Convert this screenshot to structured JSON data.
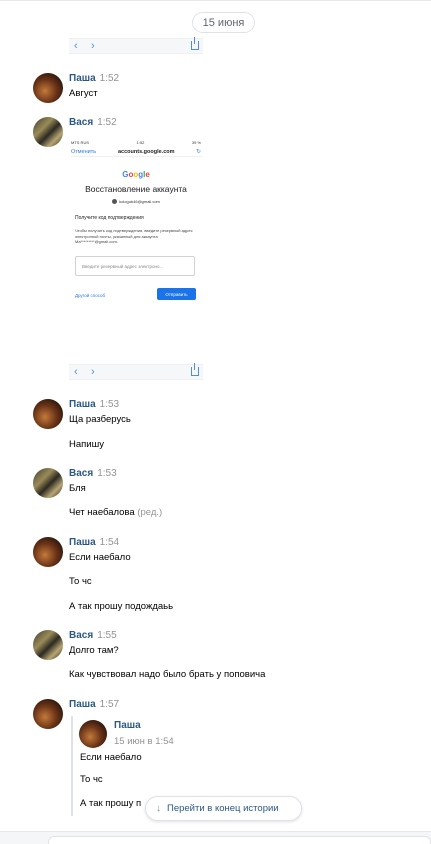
{
  "date_divider": "15 июня",
  "icons": {
    "back": "chevron-left-icon",
    "forward": "chevron-right-icon",
    "share": "share-icon",
    "jump": "arrow-down-icon"
  },
  "colors": {
    "author": "#2a5885",
    "time": "#939393",
    "accent": "#1a73e8"
  },
  "messages": [
    {
      "author": "Паша",
      "time": "1:52",
      "lines": [
        "Август"
      ]
    },
    {
      "author": "Вася",
      "time": "1:52",
      "lines": []
    },
    {
      "author": "Паша",
      "time": "1:53",
      "lines": [
        "Ща разберусь",
        "Напишу"
      ]
    },
    {
      "author": "Вася",
      "time": "1:53",
      "lines": [
        "Бля",
        "Чет наебалова"
      ],
      "edited": "(ред.)"
    },
    {
      "author": "Паша",
      "time": "1:54",
      "lines": [
        "Если наебало",
        "То чс",
        "А так прошу подождаьь"
      ]
    },
    {
      "author": "Вася",
      "time": "1:55",
      "lines": [
        "Долго там?",
        "Как чувствовал надо было брать у поповича"
      ]
    },
    {
      "author": "Паша",
      "time": "1:57",
      "lines": []
    }
  ],
  "screenshot": {
    "status": {
      "carrier": "MTS RUS",
      "time": "1:52",
      "battery": "39 %"
    },
    "cancel": "Отменить",
    "url": "accounts.google.com",
    "logo": [
      "G",
      "o",
      "o",
      "g",
      "l",
      "e"
    ],
    "title": "Восстановление аккаунта",
    "email": "kologub46@gmail.com",
    "subtitle": "Получите код подтверждения",
    "description": "Чтобы получить код подтверждения, введите резервный адрес электронной почты, указанный для аккаунта Ma*********@gmail.com.",
    "input_placeholder": "Введите резервный адрес электроно...",
    "other_method": "Другой способ",
    "send_button": "Отправить"
  },
  "forwarded": {
    "author": "Паша",
    "time": "15 июн в 1:54",
    "lines": [
      "Если наебало",
      "То чс",
      "А так прошу п"
    ]
  },
  "jump_button": "Перейти в конец истории"
}
